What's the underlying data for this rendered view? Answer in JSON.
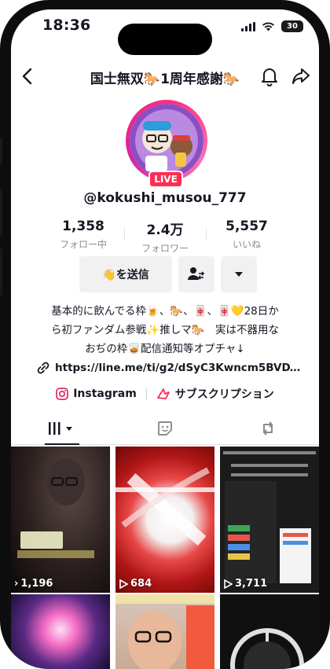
{
  "status_bar": {
    "time": "18:36",
    "battery": "30"
  },
  "header": {
    "title": "国士無双🐎1周年感謝🐎"
  },
  "profile": {
    "live_label": "LIVE",
    "username": "@kokushi_musou_777",
    "stats": [
      {
        "value": "1,358",
        "label": "フォロー中"
      },
      {
        "value": "2.4万",
        "label": "フォロワー"
      },
      {
        "value": "5,557",
        "label": "いいね"
      }
    ],
    "message_button": "👋を送信",
    "bio_lines": [
      "基本的に飲んでる枠🍺、🐎、🀄、🀄💛28日か",
      "ら初ファンダム参戦✨推しマ🐎　実は不器用な",
      "おぢの枠🥃配信通知等オプチャ↓"
    ],
    "link": "https://line.me/ti/g2/dSyC3Kwncm5BVDYr...",
    "instagram_label": "Instagram",
    "subscription_label": "サブスクリプション"
  },
  "videos": [
    {
      "count": "1,196"
    },
    {
      "count": "684"
    },
    {
      "count": "3,711"
    },
    {
      "count": ""
    },
    {
      "count": ""
    },
    {
      "count": ""
    }
  ],
  "colors": {
    "live": "#fe2c55",
    "text": "#161823",
    "muted": "#8a8b91",
    "button_bg": "#f1f1f2"
  }
}
